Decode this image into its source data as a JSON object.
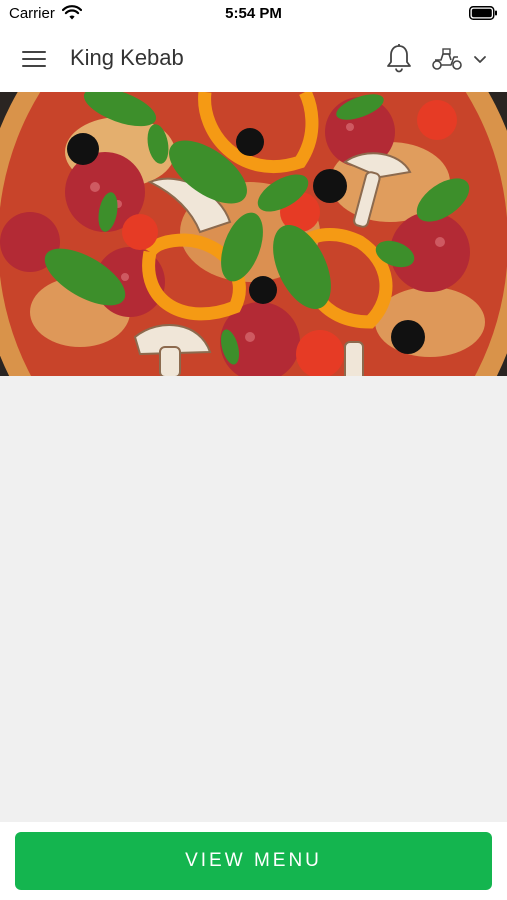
{
  "status_bar": {
    "carrier": "Carrier",
    "time": "5:54 PM",
    "wifi_icon": "wifi-icon",
    "battery_icon": "battery-icon"
  },
  "header": {
    "title": "King Kebab",
    "menu_icon": "hamburger-menu-icon",
    "notification_icon": "bell-icon",
    "delivery_icon": "scooter-icon",
    "dropdown_icon": "chevron-down-icon"
  },
  "hero": {
    "image": "pizza-photo"
  },
  "footer": {
    "button_label": "VIEW MENU"
  },
  "colors": {
    "primary_button": "#14b54f",
    "background": "#f0f0f0",
    "header_text": "#333333"
  }
}
